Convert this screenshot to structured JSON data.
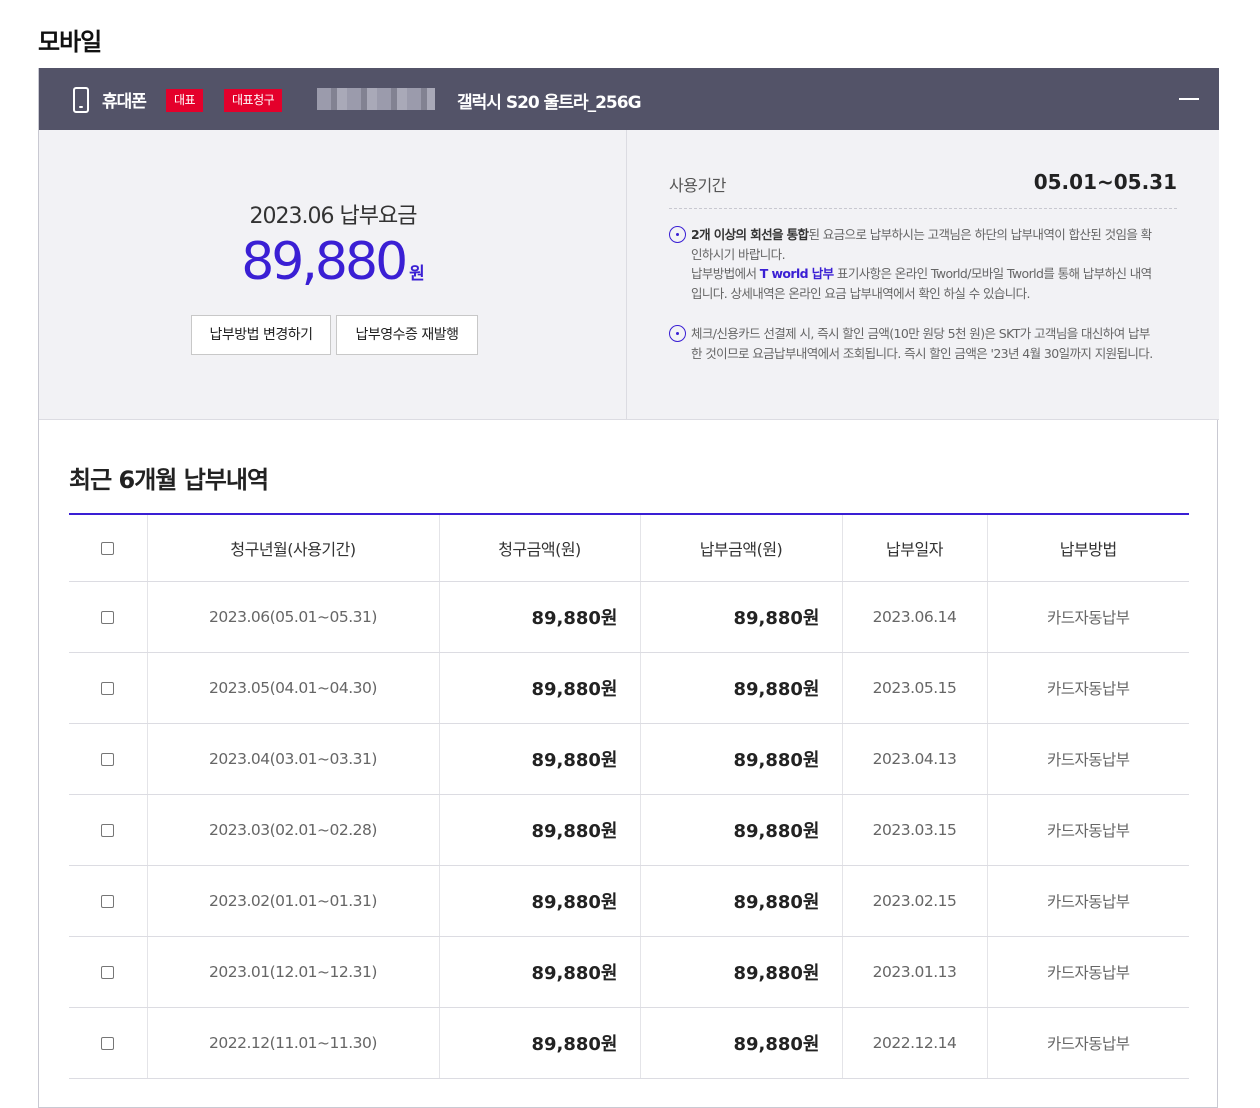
{
  "page": {
    "title": "모바일"
  },
  "line": {
    "device_type": "휴대폰",
    "badges": [
      "대표",
      "대표청구"
    ],
    "device_model": "갤럭시 S20 울트라_256G",
    "collapse_icon": "minus-icon"
  },
  "summary": {
    "bill_month": "2023.06 납부요금",
    "amount": "89,880",
    "amount_unit": "원",
    "buttons": {
      "change_method": "납부방법 변경하기",
      "reissue_receipt": "납부영수증 재발행"
    },
    "usage_label": "사용기간",
    "usage_period": "05.01~05.31",
    "notes": [
      {
        "strong": "2개 이상의 회선을 통합",
        "text_1": "된 요금으로 납부하시는 고객님은 하단의 납부내역이 합산된 것임을 확인하시기 바랍니다.",
        "text_2": "납부방법에서 ",
        "link": "T world 납부",
        "text_3": " 표기사항은 온라인 Tworld/모바일 Tworld를 통해 납부하신 내역입니다. 상세내역은 온라인 요금 납부내역에서 확인 하실 수 있습니다."
      },
      {
        "text_1": "체크/신용카드 선결제 시, 즉시 할인 금액(10만 원당 5천 원)은 SKT가 고객님을 대신하여 납부한 것이므로 요금납부내역에서 조회됩니다. 즉시 할인 금액은 '23년 4월 30일까지 지원됩니다."
      }
    ]
  },
  "history": {
    "title": "최근 6개월 납부내역",
    "columns": [
      "청구년월(사용기간)",
      "청구금액(원)",
      "납부금액(원)",
      "납부일자",
      "납부방법"
    ],
    "rows": [
      {
        "period": "2023.06(05.01~05.31)",
        "billed": "89,880원",
        "paid": "89,880원",
        "date": "2023.06.14",
        "method": "카드자동납부"
      },
      {
        "period": "2023.05(04.01~04.30)",
        "billed": "89,880원",
        "paid": "89,880원",
        "date": "2023.05.15",
        "method": "카드자동납부"
      },
      {
        "period": "2023.04(03.01~03.31)",
        "billed": "89,880원",
        "paid": "89,880원",
        "date": "2023.04.13",
        "method": "카드자동납부"
      },
      {
        "period": "2023.03(02.01~02.28)",
        "billed": "89,880원",
        "paid": "89,880원",
        "date": "2023.03.15",
        "method": "카드자동납부"
      },
      {
        "period": "2023.02(01.01~01.31)",
        "billed": "89,880원",
        "paid": "89,880원",
        "date": "2023.02.15",
        "method": "카드자동납부"
      },
      {
        "period": "2023.01(12.01~12.31)",
        "billed": "89,880원",
        "paid": "89,880원",
        "date": "2023.01.13",
        "method": "카드자동납부"
      },
      {
        "period": "2022.12(11.01~11.30)",
        "billed": "89,880원",
        "paid": "89,880원",
        "date": "2022.12.14",
        "method": "카드자동납부"
      }
    ]
  }
}
